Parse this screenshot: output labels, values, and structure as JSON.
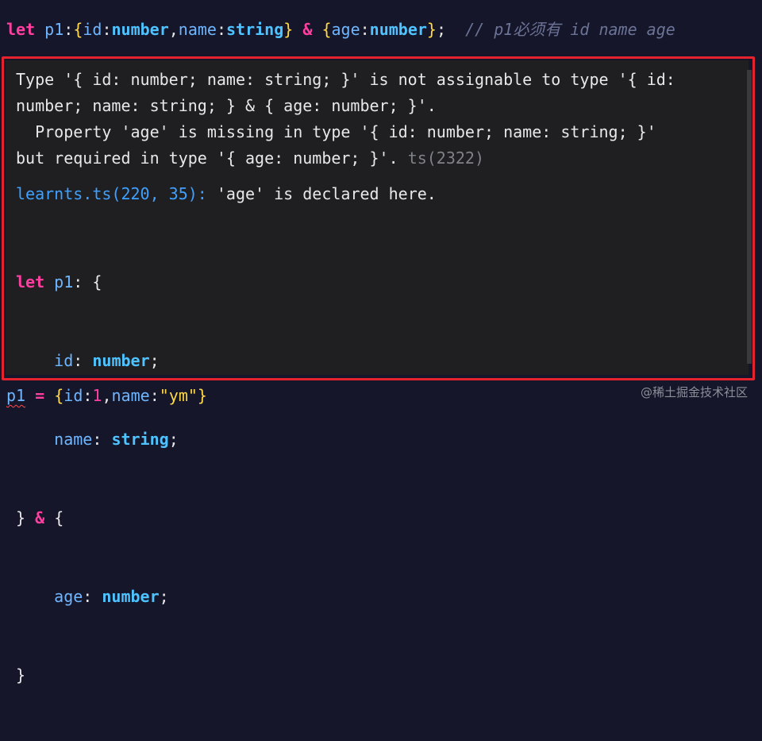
{
  "top_line": {
    "kw_let": "let",
    "var_name": "p1",
    "colon": ":",
    "brace_open": "{",
    "prop_id": "id",
    "colon2": ":",
    "type_number": "number",
    "comma": ",",
    "prop_name": "name",
    "colon3": ":",
    "type_string": "string",
    "brace_close": "}",
    "amp": "&",
    "brace_open2": "{",
    "prop_age": "age",
    "colon4": ":",
    "type_number2": "number",
    "brace_close2": "}",
    "semicolon": ";",
    "comment": "// p1必须有 id name age"
  },
  "hover": {
    "error_line1": "Type '{ id: number; name: string; }' is not assignable to type '{ id:",
    "error_line2": "number; name: string; } & { age: number; }'.",
    "error_line3": "  Property 'age' is missing in type '{ id: number; name: string; }'",
    "error_line4": "but required in type '{ age: number; }'.",
    "error_code": "ts(2322)",
    "related_link": "learnts.ts(220, 35):",
    "related_text": "'age' is declared here.",
    "sig": {
      "kw_let": "let",
      "var_name": "p1",
      "colon": ":",
      "brace_open": "{",
      "prop_id": "id",
      "type_number": "number",
      "semi1": ";",
      "prop_name": "name",
      "type_string": "string",
      "semi2": ";",
      "brace_close": "}",
      "amp": "&",
      "brace_open2": "{",
      "prop_age": "age",
      "type_number2": "number",
      "semi3": ";",
      "brace_close2": "}"
    }
  },
  "bottom_line": {
    "var_name": "p1",
    "equals": "=",
    "brace_open": "{",
    "prop_id": "id",
    "colon": ":",
    "num_value": "1",
    "comma": ",",
    "prop_name": "name",
    "colon2": ":",
    "str_value": "\"ym\"",
    "brace_close": "}"
  },
  "watermark": "@稀土掘金技术社区",
  "colors": {
    "editor_bg": "#16162a",
    "hover_bg": "#1f1f22",
    "outline": "#e5232e",
    "keyword": "#ff3fa0",
    "type": "#4fc3ff",
    "brace": "#ffd84a",
    "link": "#3fa1ff"
  }
}
